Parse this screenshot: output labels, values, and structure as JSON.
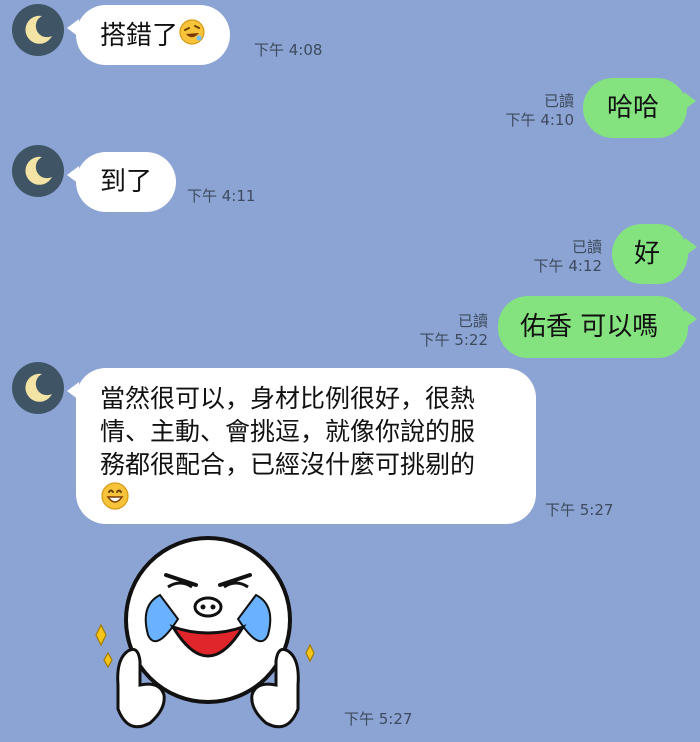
{
  "chat": {
    "colors": {
      "background": "#8ba4d3",
      "incoming_bubble": "#ffffff",
      "outgoing_bubble": "#84e37e",
      "avatar": "#3f5565",
      "meta_text": "#3e4a5e"
    },
    "avatar_icon": "crescent-moon-icon",
    "messages": [
      {
        "side": "in",
        "text": "搭錯了",
        "emoji": "rolling-laughing-emoji",
        "time": "下午 4:08"
      },
      {
        "side": "out",
        "text": "哈哈",
        "read": "已讀",
        "time": "下午 4:10"
      },
      {
        "side": "in",
        "text": "到了",
        "time": "下午 4:11"
      },
      {
        "side": "out",
        "text": "好",
        "read": "已讀",
        "time": "下午 4:12"
      },
      {
        "side": "out",
        "text": "佑香 可以嗎",
        "read": "已讀",
        "time": "下午 5:22"
      },
      {
        "side": "in",
        "lines": [
          "當然很可以，身材比例很好，很熱",
          "情、主動、會挑逗，就像你說的服",
          "務都很配合，已經沒什麼可挑剔的"
        ],
        "emoji": "grinning-face-emoji",
        "time": "下午 5:27"
      },
      {
        "side": "in",
        "type": "sticker",
        "sticker": "crying-laughing-thumbs-up-sticker",
        "time": "下午 5:27"
      }
    ]
  }
}
